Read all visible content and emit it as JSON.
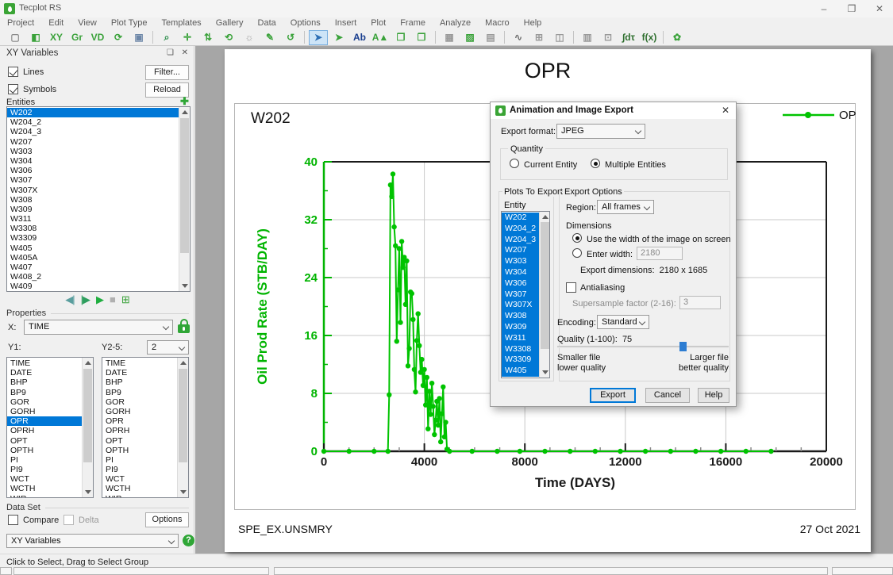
{
  "window": {
    "title": "Tecplot RS"
  },
  "glyphs": {
    "minimize": "–",
    "maximize": "❐",
    "close": "✕",
    "float": "❏",
    "plus": "✚",
    "help": "?"
  },
  "menu": {
    "items": [
      "Project",
      "Edit",
      "View",
      "Plot Type",
      "Templates",
      "Gallery",
      "Data",
      "Options",
      "Insert",
      "Plot",
      "Frame",
      "Analyze",
      "Macro",
      "Help"
    ]
  },
  "toolbar": {
    "icons": [
      {
        "name": "new-file-icon",
        "glyph": "▢",
        "color": "#8a8a8a"
      },
      {
        "name": "frame-layout-icon",
        "glyph": "◧",
        "color": "#3aa23a"
      },
      {
        "name": "load-xy-data-icon",
        "glyph": "XY",
        "color": "#3aa23a"
      },
      {
        "name": "load-grid-data-icon",
        "glyph": "Gr",
        "color": "#3aa23a"
      },
      {
        "name": "load-vdb-data-icon",
        "glyph": "VD",
        "color": "#3aa23a"
      },
      {
        "name": "reload-dataset-icon",
        "glyph": "⟳",
        "color": "#3aa23a"
      },
      {
        "name": "save-project-icon",
        "glyph": "▣",
        "color": "#6d87a8",
        "sep": true
      },
      {
        "name": "zoom-tool-icon",
        "glyph": "⌕",
        "color": "#2f8f4e"
      },
      {
        "name": "translate-tool-icon",
        "glyph": "✛",
        "color": "#3aa23a"
      },
      {
        "name": "rotate-z-tool-icon",
        "glyph": "⇅",
        "color": "#3aa23a"
      },
      {
        "name": "rotate-3d-tool-icon",
        "glyph": "⟲",
        "color": "#3aa23a"
      },
      {
        "name": "lighting-tool-icon",
        "glyph": "☼",
        "color": "#9a9a9a"
      },
      {
        "name": "restyle-tool-icon",
        "glyph": "✎",
        "color": "#3aa23a"
      },
      {
        "name": "undo-icon",
        "glyph": "↺",
        "color": "#3aa23a",
        "sep": true
      },
      {
        "name": "select-tool-icon",
        "glyph": "➤",
        "color": "#2d6fb5",
        "active": true
      },
      {
        "name": "adjust-tool-icon",
        "glyph": "➤",
        "color": "#3aa23a"
      },
      {
        "name": "add-text-tool-icon",
        "glyph": "Ab",
        "color": "#1a3f8f"
      },
      {
        "name": "contour-tool-icon",
        "glyph": "A▲",
        "color": "#3aa23a"
      },
      {
        "name": "tile-frames-icon",
        "glyph": "❒",
        "color": "#3aa23a"
      },
      {
        "name": "push-frame-icon",
        "glyph": "❐",
        "color": "#3aa23a",
        "sep": true
      },
      {
        "name": "edit-grid-icon",
        "glyph": "▦",
        "color": "#9a9a9a"
      },
      {
        "name": "append-grid-icon",
        "glyph": "▨",
        "color": "#3aa23a"
      },
      {
        "name": "grid-42-icon",
        "glyph": "▤",
        "color": "#9a9a9a",
        "sep": true
      },
      {
        "name": "probe-curve-icon",
        "glyph": "∿",
        "color": "#707070"
      },
      {
        "name": "table-view-icon",
        "glyph": "⊞",
        "color": "#9a9a9a"
      },
      {
        "name": "mirror-view-icon",
        "glyph": "◫",
        "color": "#9a9a9a",
        "sep": true
      },
      {
        "name": "column-layout-icon",
        "glyph": "▥",
        "color": "#9a9a9a"
      },
      {
        "name": "cell-values-icon",
        "glyph": "⊡",
        "color": "#9a9a9a"
      },
      {
        "name": "integrate-icon",
        "glyph": "∫dτ",
        "color": "#2f6f2f"
      },
      {
        "name": "function-calc-icon",
        "glyph": "f(x)",
        "color": "#2f6f2f",
        "sep": true
      },
      {
        "name": "tecplot-360-icon",
        "glyph": "✿",
        "color": "#3aa23a"
      }
    ]
  },
  "sidebar": {
    "title": "XY Variables",
    "lines_label": "Lines",
    "symbols_label": "Symbols",
    "filter_button": "Filter...",
    "reload_button": "Reload",
    "entities_label": "Entities",
    "entities": {
      "items": [
        "W202",
        "W204_2",
        "W204_3",
        "W207",
        "W303",
        "W304",
        "W306",
        "W307",
        "W307X",
        "W308",
        "W309",
        "W311",
        "W3308",
        "W3309",
        "W405",
        "W405A",
        "W407",
        "W408_2",
        "W409"
      ],
      "selected": "W202"
    },
    "playback": [
      {
        "name": "step-back-button",
        "glyph": "◀|",
        "color": "#5a9e9e"
      },
      {
        "name": "step-forward-button",
        "glyph": "|▶",
        "color": "#2e9e5e"
      },
      {
        "name": "play-button",
        "glyph": "▶",
        "color": "#1fae3f"
      },
      {
        "name": "stop-button",
        "glyph": "■",
        "color": "#b0b0b0"
      },
      {
        "name": "export-animation-button",
        "glyph": "⊞",
        "color": "#3aa23a"
      }
    ],
    "properties_label": "Properties",
    "x_label": "X:",
    "x_value": "TIME",
    "y1_label": "Y1:",
    "y25_label": "Y2-5:",
    "y25_value": "2",
    "variables": [
      "TIME",
      "DATE",
      "BHP",
      "BP9",
      "GOR",
      "GORH",
      "OPR",
      "OPRH",
      "OPT",
      "OPTH",
      "PI",
      "PI9",
      "WCT",
      "WCTH",
      "WIR"
    ],
    "y1_selected": "OPR",
    "dataset_label": "Data Set",
    "compare_label": "Compare",
    "delta_label": "Delta",
    "options_button": "Options",
    "mode_value": "XY Variables"
  },
  "status_text": "Click to Select, Drag to Select Group",
  "plot": {
    "entity_label": "W202",
    "footer_left": "SPE_EX.UNSMRY",
    "footer_right": "27 Oct 2021"
  },
  "chart_data": {
    "type": "line",
    "title": "OPR",
    "xlabel": "Time (DAYS)",
    "ylabel": "Oil Prod Rate (STB/DAY)",
    "xlim": [
      0,
      20000
    ],
    "ylim": [
      0,
      40
    ],
    "xticks": [
      0,
      4000,
      8000,
      12000,
      16000,
      20000
    ],
    "yticks": [
      0,
      8,
      16,
      24,
      32,
      40
    ],
    "x_minor_step": 1000,
    "y_minor_step": 4,
    "grid": true,
    "legend": [
      "OPR"
    ],
    "legend_position": "top-right",
    "line_color": "#00c300",
    "axis_color": "#00b400",
    "series": [
      {
        "name": "OPR",
        "points": [
          [
            0,
            0
          ],
          [
            1000,
            0
          ],
          [
            2000,
            0
          ],
          [
            2550,
            0
          ],
          [
            2600,
            7.8
          ],
          [
            2650,
            36.8
          ],
          [
            2700,
            35.2
          ],
          [
            2750,
            38.3
          ],
          [
            2800,
            31.0
          ],
          [
            2850,
            28.4
          ],
          [
            2900,
            15.2
          ],
          [
            2950,
            22.3
          ],
          [
            3000,
            28.0
          ],
          [
            3050,
            17.8
          ],
          [
            3100,
            29.0
          ],
          [
            3150,
            25.4
          ],
          [
            3200,
            26.8
          ],
          [
            3250,
            20.3
          ],
          [
            3300,
            26.3
          ],
          [
            3350,
            11.8
          ],
          [
            3400,
            14.2
          ],
          [
            3450,
            22.0
          ],
          [
            3500,
            21.8
          ],
          [
            3550,
            18.2
          ],
          [
            3600,
            11.3
          ],
          [
            3650,
            8.2
          ],
          [
            3700,
            15.3
          ],
          [
            3750,
            19.0
          ],
          [
            3800,
            14.6
          ],
          [
            3850,
            10.9
          ],
          [
            3900,
            12.7
          ],
          [
            3950,
            9.1
          ],
          [
            4000,
            11.3
          ],
          [
            4050,
            6.4
          ],
          [
            4100,
            10.2
          ],
          [
            4150,
            3.1
          ],
          [
            4200,
            8.3
          ],
          [
            4250,
            5.1
          ],
          [
            4300,
            9.4
          ],
          [
            4350,
            6.2
          ],
          [
            4400,
            2.3
          ],
          [
            4450,
            4.3
          ],
          [
            4500,
            6.9
          ],
          [
            4550,
            3.6
          ],
          [
            4600,
            7.3
          ],
          [
            4650,
            1.3
          ],
          [
            4700,
            5.2
          ],
          [
            4750,
            8.9
          ],
          [
            4800,
            2.0
          ],
          [
            4850,
            4.0
          ],
          [
            4900,
            0.3
          ],
          [
            5000,
            0
          ],
          [
            5900,
            0
          ],
          [
            6900,
            0
          ],
          [
            7800,
            0
          ],
          [
            8800,
            0
          ],
          [
            9800,
            0
          ],
          [
            10800,
            0
          ],
          [
            11800,
            0
          ],
          [
            12800,
            0
          ],
          [
            13800,
            0
          ],
          [
            14800,
            0
          ],
          [
            15800,
            0
          ],
          [
            16800,
            0
          ],
          [
            17800,
            0
          ]
        ]
      }
    ]
  },
  "dialog": {
    "title": "Animation and Image Export",
    "export_format_label": "Export format:",
    "export_format_value": "JPEG",
    "quantity_label": "Quantity",
    "quantity_options": [
      "Current Entity",
      "Multiple Entities"
    ],
    "quantity_selected": "Multiple Entities",
    "plots_group_label": "Plots To Export",
    "entity_label": "Entity",
    "entities": {
      "items": [
        "W202",
        "W204_2",
        "W204_3",
        "W207",
        "W303",
        "W304",
        "W306",
        "W307",
        "W307X",
        "W308",
        "W309",
        "W311",
        "W3308",
        "W3309",
        "W405"
      ],
      "selected": [
        "W202",
        "W204_2",
        "W204_3",
        "W207",
        "W303",
        "W304",
        "W306",
        "W307",
        "W307X",
        "W308",
        "W309",
        "W311",
        "W3308",
        "W3309",
        "W405"
      ]
    },
    "export_options_label": "Export Options",
    "region_label": "Region:",
    "region_value": "All frames",
    "dimensions_label": "Dimensions",
    "width_screen_option": "Use the width of the image on screen",
    "width_enter_option": "Enter width:",
    "width_value": "2180",
    "export_dims_label": "Export dimensions:",
    "export_dims_value": "2180 x 1685",
    "antialiasing_label": "Antialiasing",
    "supersample_label": "Supersample factor (2-16):",
    "supersample_value": "3",
    "encoding_label": "Encoding:",
    "encoding_value": "Standard",
    "quality_label": "Quality (1-100):",
    "quality_value": "75",
    "slider_left_line1": "Smaller file",
    "slider_left_line2": "lower quality",
    "slider_right_line1": "Larger file",
    "slider_right_line2": "better quality",
    "export_button": "Export",
    "cancel_button": "Cancel",
    "help_button": "Help"
  }
}
